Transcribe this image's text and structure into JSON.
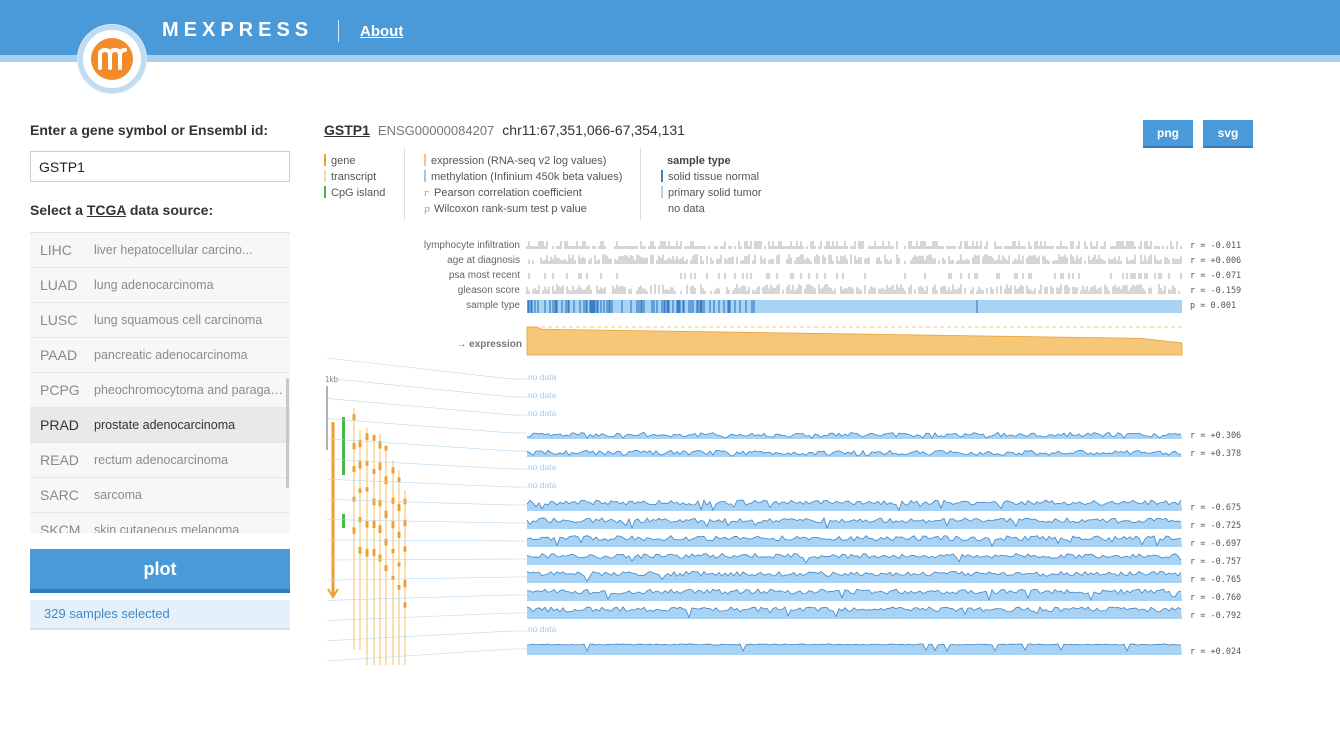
{
  "header": {
    "brand": "MEXPRESS",
    "about_label": "About",
    "logo_letter": "m"
  },
  "sidebar": {
    "gene_prompt": "Enter a gene symbol or Ensembl id:",
    "gene_value": "GSTP1",
    "source_prompt_prefix": "Select a ",
    "source_prompt_link": "TCGA",
    "source_prompt_suffix": " data source:",
    "sources": [
      {
        "code": "LIHC",
        "name": "liver hepatocellular carcino..."
      },
      {
        "code": "LUAD",
        "name": "lung adenocarcinoma"
      },
      {
        "code": "LUSC",
        "name": "lung squamous cell carcinoma"
      },
      {
        "code": "PAAD",
        "name": "pancreatic adenocarcinoma"
      },
      {
        "code": "PCPG",
        "name": "pheochromocytoma and paragan..."
      },
      {
        "code": "PRAD",
        "name": "prostate adenocarcinoma",
        "selected": true
      },
      {
        "code": "READ",
        "name": "rectum adenocarcinoma"
      },
      {
        "code": "SARC",
        "name": "sarcoma"
      },
      {
        "code": "SKCM",
        "name": "skin cutaneous melanoma"
      }
    ],
    "plot_label": "plot",
    "samples_text": "329 samples selected"
  },
  "main": {
    "gene_symbol": "GSTP1",
    "ensembl_id": "ENSG00000084207",
    "location": "chr11:67,351,066-67,354,131",
    "png_label": "png",
    "svg_label": "svg",
    "legend_col1": [
      {
        "label": "gene",
        "color": "#f0a030"
      },
      {
        "label": "transcript",
        "color": "#f7d9a8"
      },
      {
        "label": "CpG island",
        "color": "#49b649"
      }
    ],
    "legend_col2": [
      {
        "label": "expression (RNA-seq v2 log values)",
        "kind": "bar",
        "color": "#f6c777"
      },
      {
        "label": "methylation (Infinium 450k beta values)",
        "kind": "bar",
        "color": "#9cc8ee"
      },
      {
        "label": "Pearson correlation coefficient",
        "kind": "sym",
        "sym": "r"
      },
      {
        "label": "Wilcoxon rank-sum test p value",
        "kind": "sym",
        "sym": "p"
      }
    ],
    "legend_col3_title": "sample type",
    "legend_col3": [
      {
        "label": "solid tissue normal",
        "color": "#3a7fc4"
      },
      {
        "label": "primary solid tumor",
        "color": "#a8d3f5"
      },
      {
        "label": "no data",
        "color": ""
      }
    ],
    "tracks": [
      {
        "label": "lymphocyte infiltration",
        "stat": "r = -0.011"
      },
      {
        "label": "age at diagnosis",
        "stat": "r = +0.006"
      },
      {
        "label": "psa most recent",
        "stat": "r = -0.071"
      },
      {
        "label": "gleason score",
        "stat": "r = -0.159"
      },
      {
        "label": "sample type",
        "stat": "p = 0.001"
      }
    ],
    "expression_label": "→ expression",
    "scale_label": "1kb",
    "probes": [
      {
        "nodata": true,
        "label": "no data"
      },
      {
        "nodata": true,
        "label": "no data"
      },
      {
        "nodata": true,
        "label": "no data"
      },
      {
        "nodata": false,
        "stat": "r = +0.306"
      },
      {
        "nodata": false,
        "stat": "r = +0.378"
      },
      {
        "nodata": true,
        "label": "no data"
      },
      {
        "nodata": true,
        "label": "no data"
      },
      {
        "nodata": false,
        "stat": "r = -0.675"
      },
      {
        "nodata": false,
        "stat": "r = -0.725"
      },
      {
        "nodata": false,
        "stat": "r = -0.697"
      },
      {
        "nodata": false,
        "stat": "r = -0.757"
      },
      {
        "nodata": false,
        "stat": "r = -0.765"
      },
      {
        "nodata": false,
        "stat": "r = -0.760"
      },
      {
        "nodata": false,
        "stat": "r = -0.792"
      },
      {
        "nodata": true,
        "label": "no data"
      },
      {
        "nodata": false,
        "stat": "r = +0.024"
      }
    ],
    "colors": {
      "accent": "#4a9ad9",
      "expression": "#f6c777",
      "methylation": "#a8d3f5",
      "methylation_line": "#3f86c6",
      "normal": "#3a7fc4",
      "gene": "#f0a030",
      "cpg": "#49b649"
    }
  }
}
